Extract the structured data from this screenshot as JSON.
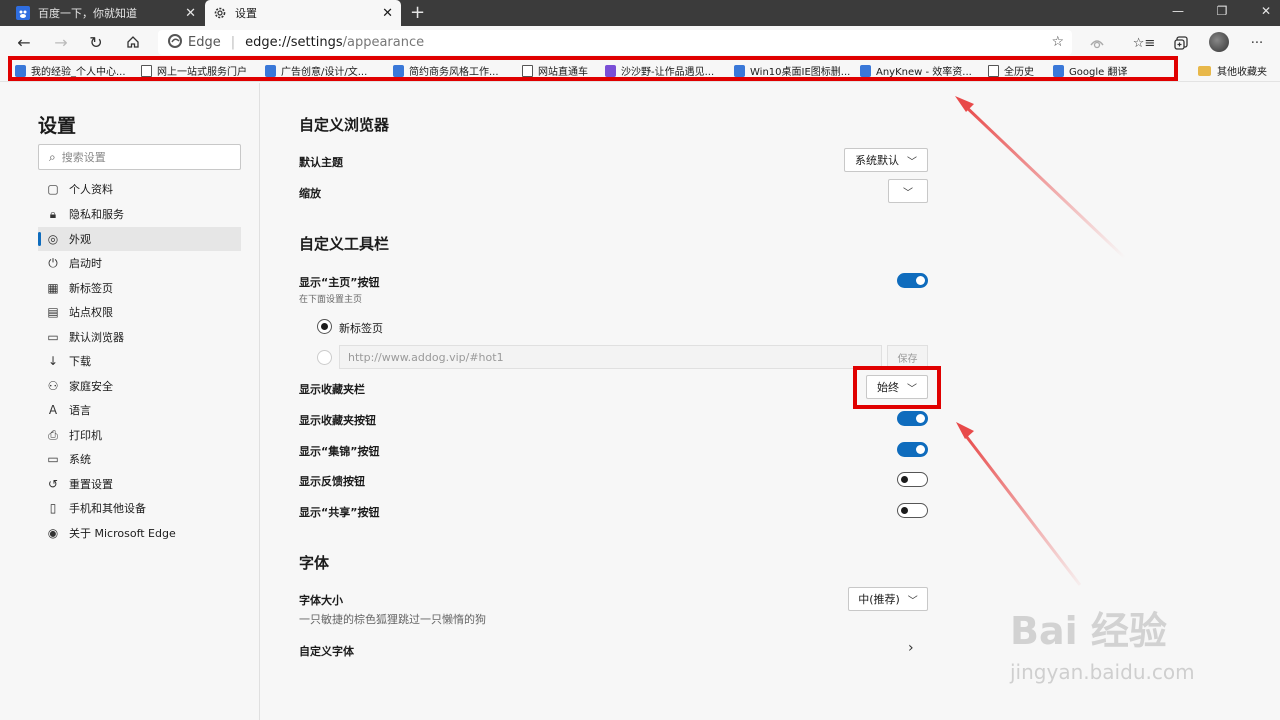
{
  "tabs": [
    {
      "title": "百度一下，你就知道"
    },
    {
      "title": "设置"
    }
  ],
  "window": {
    "new_tab": "+",
    "minimize": "—",
    "maximize": "❐",
    "close": "✕",
    "tab_close": "✕"
  },
  "address_bar": {
    "site_name": "Edge",
    "url_host": "edge://settings",
    "url_path": "/appearance"
  },
  "favorites": [
    "我的经验_个人中心...",
    "网上一站式服务门户",
    "广告创意/设计/文...",
    "简约商务风格工作...",
    "网站直通车",
    "沙沙野-让作品遇见...",
    "Win10桌面IE图标删...",
    "AnyKnew - 效率资...",
    "全历史",
    "Google 翻译"
  ],
  "favorites_other": "其他收藏夹",
  "sidebar": {
    "title": "设置",
    "search_placeholder": "搜索设置",
    "items": [
      {
        "label": "个人资料",
        "icon": "person-icon"
      },
      {
        "label": "隐私和服务",
        "icon": "lock-icon"
      },
      {
        "label": "外观",
        "icon": "palette-icon"
      },
      {
        "label": "启动时",
        "icon": "power-icon"
      },
      {
        "label": "新标签页",
        "icon": "grid-icon"
      },
      {
        "label": "站点权限",
        "icon": "site-permissions-icon"
      },
      {
        "label": "默认浏览器",
        "icon": "browser-icon"
      },
      {
        "label": "下载",
        "icon": "download-icon"
      },
      {
        "label": "家庭安全",
        "icon": "family-icon"
      },
      {
        "label": "语言",
        "icon": "language-icon"
      },
      {
        "label": "打印机",
        "icon": "printer-icon"
      },
      {
        "label": "系统",
        "icon": "laptop-icon"
      },
      {
        "label": "重置设置",
        "icon": "reset-icon"
      },
      {
        "label": "手机和其他设备",
        "icon": "phone-icon"
      },
      {
        "label": "关于 Microsoft Edge",
        "icon": "edge-icon"
      }
    ]
  },
  "content": {
    "customize_browser": {
      "title": "自定义浏览器",
      "theme_label": "默认主题",
      "theme_value": "系统默认",
      "zoom_label": "缩放",
      "zoom_value": ""
    },
    "customize_toolbar": {
      "title": "自定义工具栏",
      "home_button_label": "显示“主页”按钮",
      "home_button_sub": "在下面设置主页",
      "home_button_on": true,
      "radio_new_tab": "新标签页",
      "url_placeholder": "http://www.addog.vip/#hot1",
      "save_label": "保存",
      "favbar_label": "显示收藏夹栏",
      "favbar_value": "始终",
      "fav_button_label": "显示收藏夹按钮",
      "fav_button_on": true,
      "collections_label": "显示“集锦”按钮",
      "collections_on": true,
      "feedback_label": "显示反馈按钮",
      "feedback_on": false,
      "share_label": "显示“共享”按钮",
      "share_on": false
    },
    "fonts": {
      "title": "字体",
      "size_label": "字体大小",
      "size_value": "中(推荐)",
      "sample": "一只敏捷的棕色狐狸跳过一只懒惰的狗",
      "custom_label": "自定义字体"
    }
  },
  "watermark": {
    "logo": "Bai 经验",
    "url": "jingyan.baidu.com"
  },
  "colors": {
    "accent": "#0f6cbd",
    "highlight": "#e00000"
  }
}
